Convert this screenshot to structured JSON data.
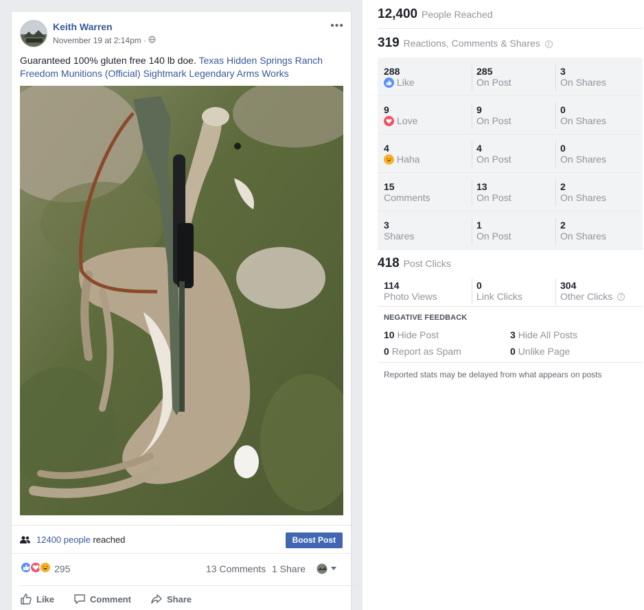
{
  "post": {
    "author": "Keith Warren",
    "timestamp": "November 19 at 2:14pm ·",
    "privacy_icon": "globe-icon",
    "more_label": "•••",
    "text": "Guaranteed 100% gluten free 140 lb doe.",
    "tags": [
      "Texas Hidden Springs Ranch",
      "Freedom Munitions (Official)",
      "Sightmark",
      "Legendary Arms Works"
    ],
    "reach_link": "12400 people",
    "reach_suffix": "reached",
    "boost_label": "Boost Post",
    "reaction_count": "295",
    "comments_count": "13 Comments",
    "shares_count": "1 Share",
    "actions": {
      "like": "Like",
      "comment": "Comment",
      "share": "Share"
    }
  },
  "insights": {
    "people_reached": {
      "num": "12,400",
      "label": "People Reached"
    },
    "engagement": {
      "num": "319",
      "label": "Reactions, Comments & Shares"
    },
    "rows": [
      {
        "v1": "288",
        "l1": "Like",
        "icon": "like",
        "v2": "285",
        "l2": "On Post",
        "v3": "3",
        "l3": "On Shares"
      },
      {
        "v1": "9",
        "l1": "Love",
        "icon": "love",
        "v2": "9",
        "l2": "On Post",
        "v3": "0",
        "l3": "On Shares"
      },
      {
        "v1": "4",
        "l1": "Haha",
        "icon": "haha",
        "v2": "4",
        "l2": "On Post",
        "v3": "0",
        "l3": "On Shares"
      },
      {
        "v1": "15",
        "l1": "Comments",
        "icon": "",
        "v2": "13",
        "l2": "On Post",
        "v3": "2",
        "l3": "On Shares"
      },
      {
        "v1": "3",
        "l1": "Shares",
        "icon": "",
        "v2": "1",
        "l2": "On Post",
        "v3": "2",
        "l3": "On Shares"
      }
    ],
    "post_clicks": {
      "num": "418",
      "label": "Post Clicks"
    },
    "clicks": [
      {
        "v": "114",
        "l": "Photo Views"
      },
      {
        "v": "0",
        "l": "Link Clicks"
      },
      {
        "v": "304",
        "l": "Other Clicks"
      }
    ],
    "negative_title": "NEGATIVE FEEDBACK",
    "negative": [
      {
        "v": "10",
        "l": "Hide Post"
      },
      {
        "v": "3",
        "l": "Hide All Posts"
      },
      {
        "v": "0",
        "l": "Report as Spam"
      },
      {
        "v": "0",
        "l": "Unlike Page"
      }
    ],
    "note": "Reported stats may be delayed from what appears on posts"
  },
  "colors": {
    "link": "#365899",
    "boost": "#4267b2",
    "like": "#5890ff",
    "love": "#f25268",
    "haha": "#f7b125"
  }
}
